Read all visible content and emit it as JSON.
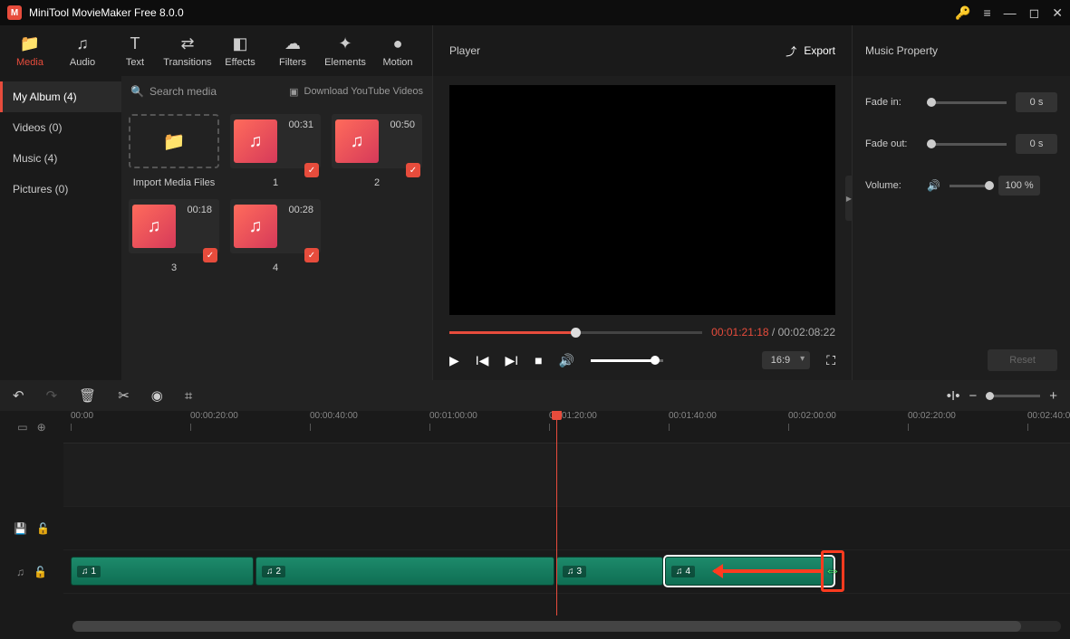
{
  "app": {
    "title": "MiniTool MovieMaker Free 8.0.0"
  },
  "tabs": {
    "media": "Media",
    "audio": "Audio",
    "text": "Text",
    "transitions": "Transitions",
    "effects": "Effects",
    "filters": "Filters",
    "elements": "Elements",
    "motion": "Motion"
  },
  "albums": {
    "myalbum": "My Album (4)",
    "videos": "Videos (0)",
    "music": "Music (4)",
    "pictures": "Pictures (0)"
  },
  "mediaToolbar": {
    "searchPlaceholder": "Search media",
    "downloadLabel": "Download YouTube Videos"
  },
  "mediaItems": {
    "import": "Import Media Files",
    "c1": {
      "dur": "00:31",
      "name": "1"
    },
    "c2": {
      "dur": "00:50",
      "name": "2"
    },
    "c3": {
      "dur": "00:18",
      "name": "3"
    },
    "c4": {
      "dur": "00:28",
      "name": "4"
    }
  },
  "player": {
    "title": "Player",
    "export": "Export",
    "current": "00:01:21:18",
    "sep": " / ",
    "total": "00:02:08:22",
    "aspect": "16:9",
    "progressPct": 48
  },
  "props": {
    "title": "Music Property",
    "fadeInLabel": "Fade in:",
    "fadeInValue": "0 s",
    "fadeOutLabel": "Fade out:",
    "fadeOutValue": "0 s",
    "volumeLabel": "Volume:",
    "volumeValue": "100 %",
    "reset": "Reset"
  },
  "ruler": {
    "t0": "00:00",
    "t1": "00:00:20:00",
    "t2": "00:00:40:00",
    "t3": "00:01:00:00",
    "t4": "00:01:20:00",
    "t5": "00:01:40:00",
    "t6": "00:02:00:00",
    "t7": "00:02:20:00",
    "t8": "00:02:40:00"
  },
  "clips": {
    "c1": "1",
    "c2": "2",
    "c3": "3",
    "c4": "4"
  }
}
